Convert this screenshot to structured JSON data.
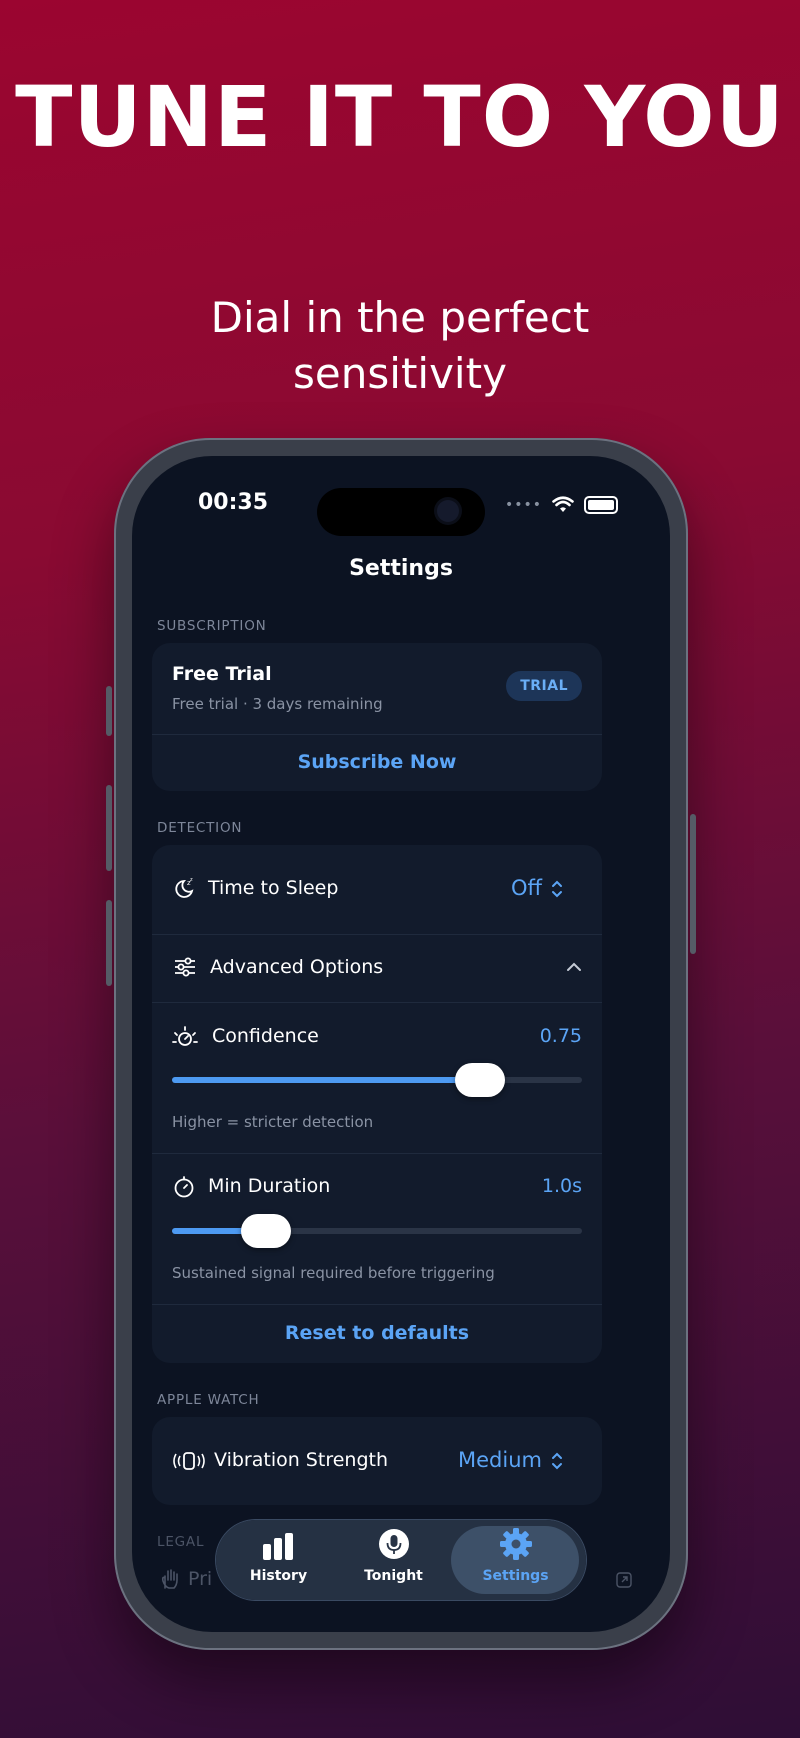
{
  "promo": {
    "headline": "TUNE IT TO YOU",
    "subline_1": "Dial in the perfect",
    "subline_2": "sensitivity"
  },
  "status_bar": {
    "time": "00:35"
  },
  "nav": {
    "title": "Settings"
  },
  "subscription": {
    "section_label": "SUBSCRIPTION",
    "plan_title": "Free Trial",
    "plan_detail": "Free trial · 3 days remaining",
    "badge": "TRIAL",
    "subscribe_label": "Subscribe Now"
  },
  "detection": {
    "section_label": "DETECTION",
    "time_to_sleep": {
      "label": "Time to Sleep",
      "value": "Off"
    },
    "advanced_label": "Advanced Options",
    "confidence": {
      "label": "Confidence",
      "value": "0.75",
      "level": 0.75,
      "hint": "Higher = stricter detection"
    },
    "min_duration": {
      "label": "Min Duration",
      "value": "1.0s",
      "level": 0.23,
      "hint": "Sustained signal required before triggering"
    },
    "reset_label": "Reset to defaults"
  },
  "apple_watch": {
    "section_label": "APPLE WATCH",
    "vibration": {
      "label": "Vibration Strength",
      "value": "Medium"
    }
  },
  "legal": {
    "section_label": "LEGAL",
    "privacy_label": "Pri"
  },
  "tabbar": {
    "items": [
      {
        "label": "History",
        "icon": "bar-chart-icon"
      },
      {
        "label": "Tonight",
        "icon": "microphone-icon"
      },
      {
        "label": "Settings",
        "icon": "gear-icon"
      }
    ],
    "active": "Settings"
  },
  "colors": {
    "accent": "#5ba4f5",
    "card": "#121b2c",
    "screen": "#0c1322"
  }
}
